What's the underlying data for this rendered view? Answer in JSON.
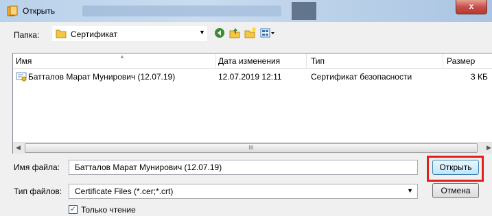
{
  "window": {
    "title": "Открыть",
    "close_label": "x"
  },
  "toolbar": {
    "folder_label": "Папка:",
    "folder_value": "Сертификат"
  },
  "columns": {
    "name": "Имя",
    "modified": "Дата изменения",
    "type": "Тип",
    "size": "Размер"
  },
  "files": [
    {
      "name": "Батталов Марат Мунирович (12.07.19)",
      "modified": "12.07.2019 12:11",
      "type": "Сертификат безопасности",
      "size": "3 КБ"
    }
  ],
  "scroll": {
    "grip": "III"
  },
  "form": {
    "filename_label": "Имя файла:",
    "filename_value": "Батталов Марат Мунирович (12.07.19)",
    "filetype_label": "Тип файлов:",
    "filetype_value": "Certificate Files (*.cer;*.crt)",
    "open_button": "Открыть",
    "cancel_button": "Отмена",
    "readonly_label": "Только чтение",
    "readonly_checked": true
  },
  "colors": {
    "highlight": "#e0201b",
    "close": "#c75050"
  }
}
